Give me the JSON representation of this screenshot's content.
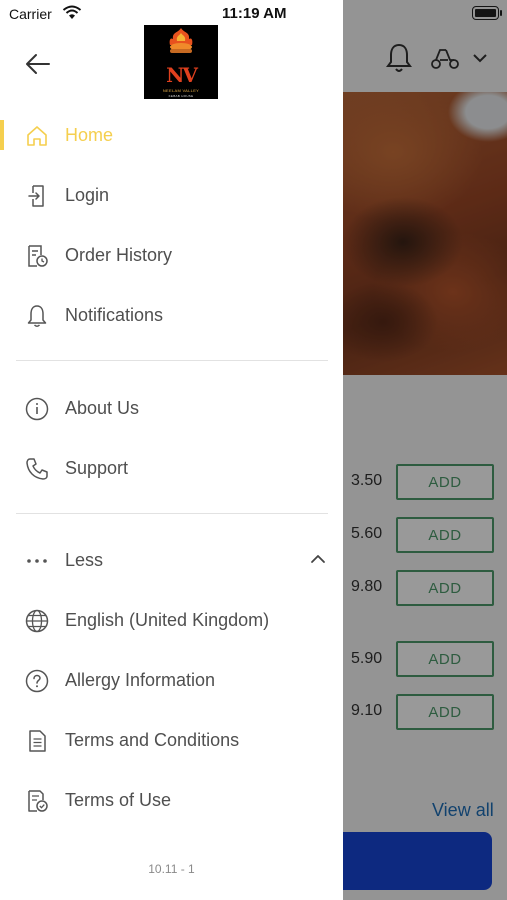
{
  "status_bar": {
    "carrier": "Carrier",
    "time": "11:19 AM"
  },
  "drawer": {
    "logo_text": "NV",
    "logo_subtitle": "NEELAM VALLEY",
    "logo_tagline": "KEBAB HOUSE",
    "primary_items": [
      {
        "label": "Home",
        "icon": "home-icon",
        "active": true
      },
      {
        "label": "Login",
        "icon": "login-icon"
      },
      {
        "label": "Order History",
        "icon": "order-history-icon"
      },
      {
        "label": "Notifications",
        "icon": "bell-icon"
      }
    ],
    "secondary_items": [
      {
        "label": "About Us",
        "icon": "info-icon"
      },
      {
        "label": "Support",
        "icon": "phone-icon"
      }
    ],
    "more_toggle": {
      "label": "Less",
      "icon": "more-dots-icon",
      "expanded": true
    },
    "more_items": [
      {
        "label": "English (United Kingdom)",
        "icon": "globe-icon"
      },
      {
        "label": "Allergy Information",
        "icon": "question-icon"
      },
      {
        "label": "Terms and Conditions",
        "icon": "document-icon"
      },
      {
        "label": "Terms of Use",
        "icon": "document-check-icon"
      }
    ],
    "version": "10.11 - 1"
  },
  "background": {
    "prices": [
      "3.50",
      "5.60",
      "9.80",
      "5.90",
      "9.10"
    ],
    "add_label": "ADD",
    "view_all": "View all"
  },
  "colors": {
    "accent": "#f5cf4e",
    "add_green": "#4e9a6b",
    "link_blue": "#1e6fb8",
    "cta_blue": "#1745d6"
  }
}
